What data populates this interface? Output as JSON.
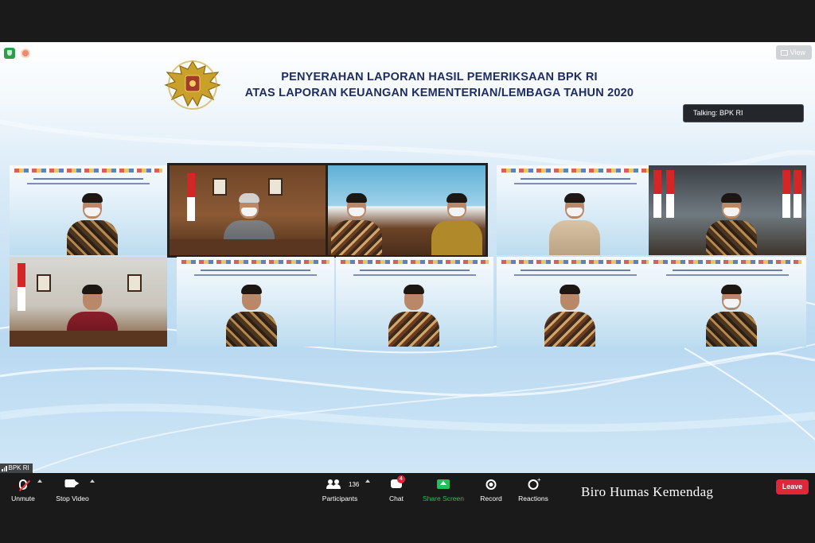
{
  "window": {
    "view_label": "View"
  },
  "slide": {
    "title_line1": "PENYERAHAN LAPORAN HASIL PEMERIKSAAN BPK RI",
    "title_line2": "ATAS LAPORAN KEUANGAN KEMENTERIAN/LEMBAGA TAHUN 2020"
  },
  "talking_indicator": "Talking: BPK RI",
  "self_view_label": "BPK RI",
  "toolbar": {
    "unmute": "Unmute",
    "stop_video": "Stop Video",
    "participants": "Participants",
    "participants_count": "136",
    "chat": "Chat",
    "chat_badge": "4",
    "share_screen": "Share Screen",
    "record": "Record",
    "reactions": "Reactions",
    "leave": "Leave"
  },
  "watermark": "Biro Humas Kemendag",
  "colors": {
    "accent_green": "#21c05a",
    "leave_red": "#e0273a",
    "title_navy": "#1f2c63"
  },
  "icons": [
    "shield-icon",
    "record-status-icon",
    "view-grid-icon",
    "mic-muted-icon",
    "video-icon",
    "participants-icon",
    "chat-icon",
    "share-screen-icon",
    "record-icon",
    "reactions-icon",
    "signal-bars-icon",
    "emblem-garuda-icon"
  ]
}
